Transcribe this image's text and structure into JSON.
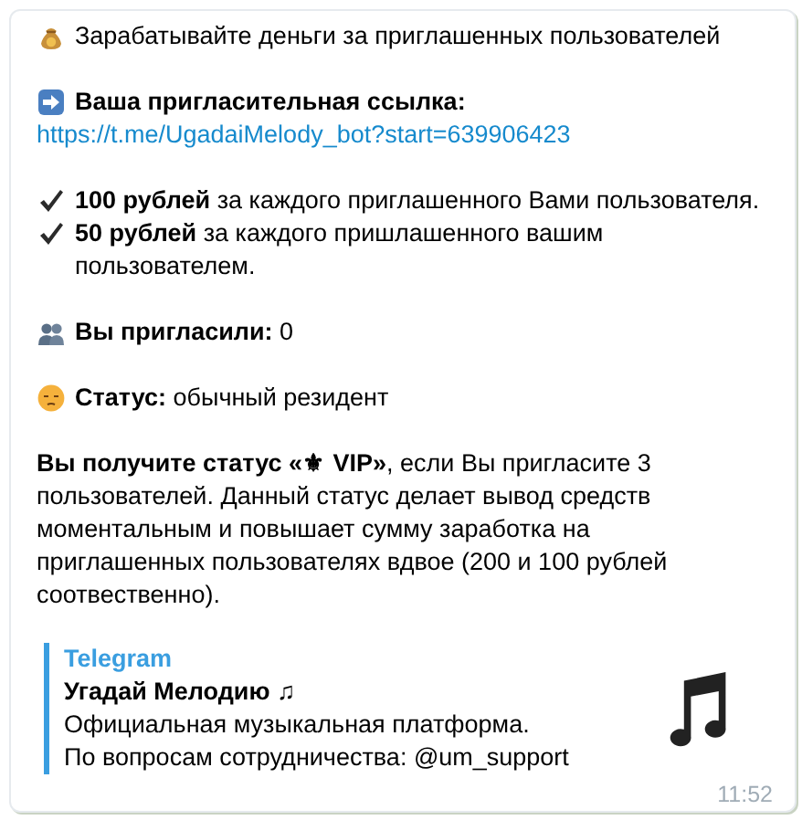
{
  "message": {
    "paragraphs": [
      {
        "lines": [
          {
            "kind": "money",
            "text": "Зарабатывайте деньги за приглашенных пользователей"
          }
        ]
      },
      {
        "lines": [
          {
            "kind": "arrow",
            "text": "**Ваша пригласительная ссылка:**"
          },
          {
            "kind": "link",
            "text": "https://t.me/UgadaiMelody_bot?start=639906423"
          }
        ]
      },
      {
        "lines": [
          {
            "kind": "check",
            "text": "**100 рублей** за каждого приглашенного Вами пользователя."
          },
          {
            "kind": "check",
            "text": "**50 рублей** за каждого пришлашенного вашим\nпользователем."
          }
        ]
      },
      {
        "lines": [
          {
            "kind": "people",
            "text": "**Вы пригласили:** 0"
          }
        ]
      },
      {
        "lines": [
          {
            "kind": "face",
            "text": "**Статус:** обычный резидент"
          }
        ]
      },
      {
        "lines": [
          {
            "kind": "text",
            "text": "**Вы получите статус «⚜ VIP»**, если Вы пригласите 3\nпользователей. Данный статус делает вывод средств\nмоментальным и повышает сумму заработка на\nприглашенных пользователях вдвое (200 и 100 рублей\nсоотвественно)."
          }
        ]
      }
    ],
    "preview": {
      "site": "Telegram",
      "title": "Угадай Мелодию ♫",
      "description": "Официальная музыкальная платформа.\nПо вопросам сотрудничества: @um_support"
    },
    "time": "11:52"
  }
}
